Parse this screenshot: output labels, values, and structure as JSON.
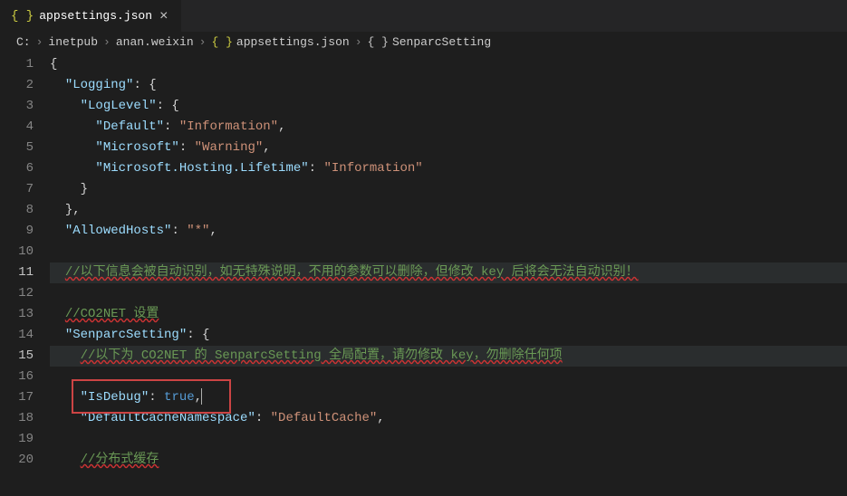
{
  "tab": {
    "icon": "{ }",
    "label": "appsettings.json",
    "close": "×"
  },
  "breadcrumb": {
    "items": [
      "C:",
      "inetpub",
      "anan.weixin",
      "appsettings.json",
      "SenparcSetting"
    ],
    "sep": "›",
    "json_icon": "{ }",
    "brace_icon": "{ }"
  },
  "lines": {
    "l1": "{",
    "l2_key": "\"Logging\"",
    "l2_rest": ": {",
    "l3_key": "\"LogLevel\"",
    "l3_rest": ": {",
    "l4_key": "\"Default\"",
    "l4_str": "\"Information\"",
    "l5_key": "\"Microsoft\"",
    "l5_str": "\"Warning\"",
    "l6_key": "\"Microsoft.Hosting.Lifetime\"",
    "l6_str": "\"Information\"",
    "l7": "}",
    "l8": "},",
    "l9_key": "\"AllowedHosts\"",
    "l9_str": "\"*\"",
    "l11": "//以下信息会被自动识别，如无特殊说明，不用的参数可以删除，但修改 key 后将会无法自动识别！",
    "l13": "//CO2NET 设置",
    "l14_key": "\"SenparcSetting\"",
    "l14_rest": ": {",
    "l15": "//以下为 CO2NET 的 SenparcSetting 全局配置，请勿修改 key，勿删除任何项",
    "l17_key": "\"IsDebug\"",
    "l17_bool": "true",
    "l18_key": "\"DefaultCacheNamespace\"",
    "l18_str": "\"DefaultCache\"",
    "l20": "//分布式缓存"
  },
  "line_numbers": [
    "1",
    "2",
    "3",
    "4",
    "5",
    "6",
    "7",
    "8",
    "9",
    "10",
    "11",
    "12",
    "13",
    "14",
    "15",
    "16",
    "17",
    "18",
    "19",
    "20"
  ],
  "highlight_lines": [
    11,
    15
  ]
}
